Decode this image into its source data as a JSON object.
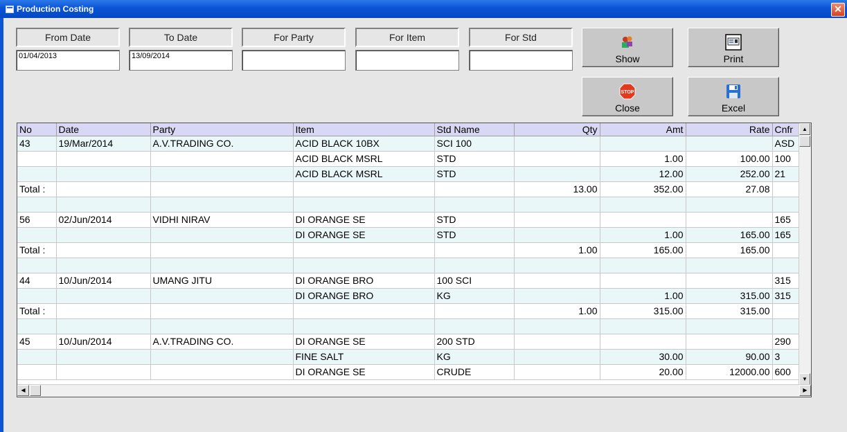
{
  "window": {
    "title": "Production Costing",
    "close_glyph": "✕"
  },
  "filters": [
    {
      "label": "From Date",
      "value": "01/04/2013"
    },
    {
      "label": "To Date",
      "value": "13/09/2014"
    },
    {
      "label": "For Party",
      "value": ""
    },
    {
      "label": "For Item",
      "value": ""
    },
    {
      "label": "For Std",
      "value": ""
    }
  ],
  "buttons": {
    "show": {
      "label": "Show",
      "icon": "users-icon"
    },
    "print": {
      "label": "Print",
      "icon": "printer-icon"
    },
    "close": {
      "label": "Close",
      "icon": "stop-sign-icon",
      "icon_text": "STOP"
    },
    "excel": {
      "label": "Excel",
      "icon": "floppy-disk-icon"
    }
  },
  "grid": {
    "columns": [
      "No",
      "Date",
      "Party",
      "Item",
      "Std Name",
      "Qty",
      "Amt",
      "Rate",
      "Cnfr"
    ],
    "rows": [
      [
        "43",
        "19/Mar/2014",
        "A.V.TRADING CO.",
        "ACID BLACK 10BX",
        "SCI 100",
        "",
        "",
        "",
        "ASD"
      ],
      [
        "",
        "",
        "",
        "ACID BLACK MSRL",
        "STD",
        "",
        "1.00",
        "100.00",
        "100"
      ],
      [
        "",
        "",
        "",
        "ACID BLACK MSRL",
        "STD",
        "",
        "12.00",
        "252.00",
        "21"
      ],
      [
        "Total :",
        "",
        "",
        "",
        "",
        "13.00",
        "352.00",
        "27.08",
        ""
      ],
      [
        "",
        "",
        "",
        "",
        "",
        "",
        "",
        "",
        ""
      ],
      [
        "56",
        "02/Jun/2014",
        "VIDHI NIRAV",
        "DI ORANGE SE",
        "STD",
        "",
        "",
        "",
        "165"
      ],
      [
        "",
        "",
        "",
        "DI ORANGE SE",
        "STD",
        "",
        "1.00",
        "165.00",
        "165"
      ],
      [
        "Total :",
        "",
        "",
        "",
        "",
        "1.00",
        "165.00",
        "165.00",
        ""
      ],
      [
        "",
        "",
        "",
        "",
        "",
        "",
        "",
        "",
        ""
      ],
      [
        "44",
        "10/Jun/2014",
        "UMANG JITU",
        "DI ORANGE BRO",
        "100 SCI",
        "",
        "",
        "",
        "315"
      ],
      [
        "",
        "",
        "",
        "DI ORANGE BRO",
        "KG",
        "",
        "1.00",
        "315.00",
        "315"
      ],
      [
        "Total :",
        "",
        "",
        "",
        "",
        "1.00",
        "315.00",
        "315.00",
        ""
      ],
      [
        "",
        "",
        "",
        "",
        "",
        "",
        "",
        "",
        ""
      ],
      [
        "45",
        "10/Jun/2014",
        "A.V.TRADING CO.",
        "DI ORANGE SE",
        "200 STD",
        "",
        "",
        "",
        "290"
      ],
      [
        "",
        "",
        "",
        "FINE SALT",
        "KG",
        "",
        "30.00",
        "90.00",
        "3"
      ],
      [
        "",
        "",
        "",
        "DI ORANGE SE",
        "CRUDE",
        "",
        "20.00",
        "12000.00",
        "600"
      ]
    ]
  }
}
